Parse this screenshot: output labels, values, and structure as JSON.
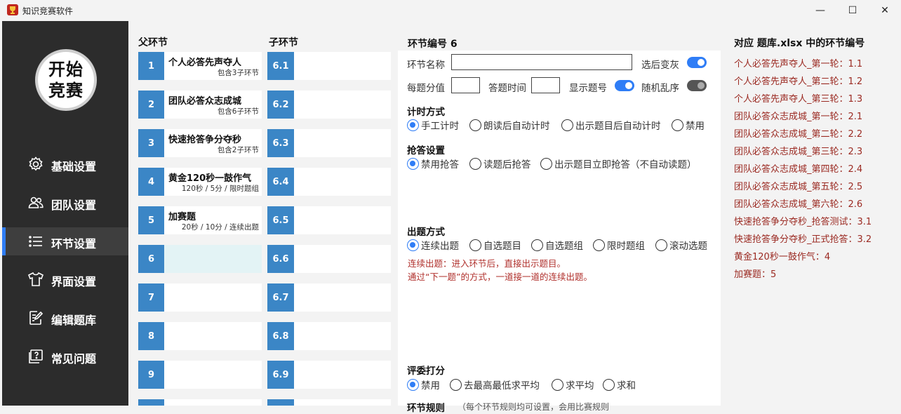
{
  "window": {
    "title": "知识竞赛软件",
    "minimize": "—",
    "maximize": "☐",
    "close": "✕"
  },
  "logo": {
    "line1": "开始",
    "line2": "竞赛"
  },
  "sidebar": {
    "items": [
      {
        "label": "基础设置",
        "icon": "gear-icon"
      },
      {
        "label": "团队设置",
        "icon": "users-icon"
      },
      {
        "label": "环节设置",
        "icon": "list-icon"
      },
      {
        "label": "界面设置",
        "icon": "shirt-icon"
      },
      {
        "label": "编辑题库",
        "icon": "edit-icon"
      },
      {
        "label": "常见问题",
        "icon": "help-icon"
      }
    ],
    "active_index": 2
  },
  "parent": {
    "header": "父环节",
    "rows": [
      {
        "num": "1",
        "name": "个人必答先声夺人",
        "sub": "包含3子环节"
      },
      {
        "num": "2",
        "name": "团队必答众志成城",
        "sub": "包含6子环节"
      },
      {
        "num": "3",
        "name": "快速抢答争分夺秒",
        "sub": "包含2子环节"
      },
      {
        "num": "4",
        "name": "黄金120秒一鼓作气",
        "sub": "120秒 / 5分 / 限时题组"
      },
      {
        "num": "5",
        "name": "加赛题",
        "sub": "20秒 / 10分 / 连续出题"
      },
      {
        "num": "6",
        "name": "",
        "sub": ""
      },
      {
        "num": "7",
        "name": "",
        "sub": ""
      },
      {
        "num": "8",
        "name": "",
        "sub": ""
      },
      {
        "num": "9",
        "name": "",
        "sub": ""
      }
    ],
    "selected_index": 5
  },
  "child": {
    "header": "子环节",
    "rows": [
      "6.1",
      "6.2",
      "6.3",
      "6.4",
      "6.5",
      "6.6",
      "6.7",
      "6.8",
      "6.9"
    ]
  },
  "detail": {
    "heading": "环节编号 6",
    "name_label": "环节名称",
    "name_value": "",
    "gray_after_label": "选后变灰",
    "gray_after_on": true,
    "score_label": "每题分值",
    "score_value": "",
    "time_label": "答题时间",
    "time_value": "",
    "show_number_label": "显示题号",
    "show_number_on": true,
    "shuffle_label": "随机乱序",
    "shuffle_on": false,
    "timing": {
      "label": "计时方式",
      "options": [
        "手工计时",
        "朗读后自动计时",
        "出示题目后自动计时",
        "禁用"
      ],
      "selected": 0
    },
    "buzzer": {
      "label": "抢答设置",
      "options": [
        "禁用抢答",
        "读题后抢答",
        "出示题目立即抢答（不自动读题）"
      ],
      "selected": 0
    },
    "question_mode": {
      "label": "出题方式",
      "options": [
        "连续出题",
        "自选题目",
        "自选题组",
        "限时题组",
        "滚动选题"
      ],
      "selected": 0,
      "desc1": "连续出题：进入环节后，直接出示题目。",
      "desc2": "通过“下一题”的方式，一道接一道的连续出题。"
    },
    "judging": {
      "label": "评委打分",
      "options": [
        "禁用",
        "去最高最低求平均",
        "求平均",
        "求和"
      ],
      "selected": 0
    },
    "rules_label": "环节规则",
    "rules_note": "（每个环节规则均可设置，会用比赛规则"
  },
  "mapping": {
    "header": "对应 题库.xlsx 中的环节编号",
    "items": [
      "个人必答先声夺人_第一轮：1.1",
      "个人必答先声夺人_第二轮：1.2",
      "个人必答先声夺人_第三轮：1.3",
      "团队必答众志成城_第一轮：2.1",
      "团队必答众志成城_第二轮：2.2",
      "团队必答众志成城_第三轮：2.3",
      "团队必答众志成城_第四轮：2.4",
      "团队必答众志成城_第五轮：2.5",
      "团队必答众志成城_第六轮：2.6",
      "快速抢答争分夺秒_抢答测试：3.1",
      "快速抢答争分夺秒_正式抢答：3.2",
      "黄金120秒一鼓作气：4",
      "加赛题：5"
    ]
  },
  "colors": {
    "accent": "#2f7df6",
    "row_number_bg": "#3b86c6",
    "sidebar_bg": "#2c2c2c",
    "mapping_text": "#9b2a22",
    "desc_text": "#b0302c"
  }
}
